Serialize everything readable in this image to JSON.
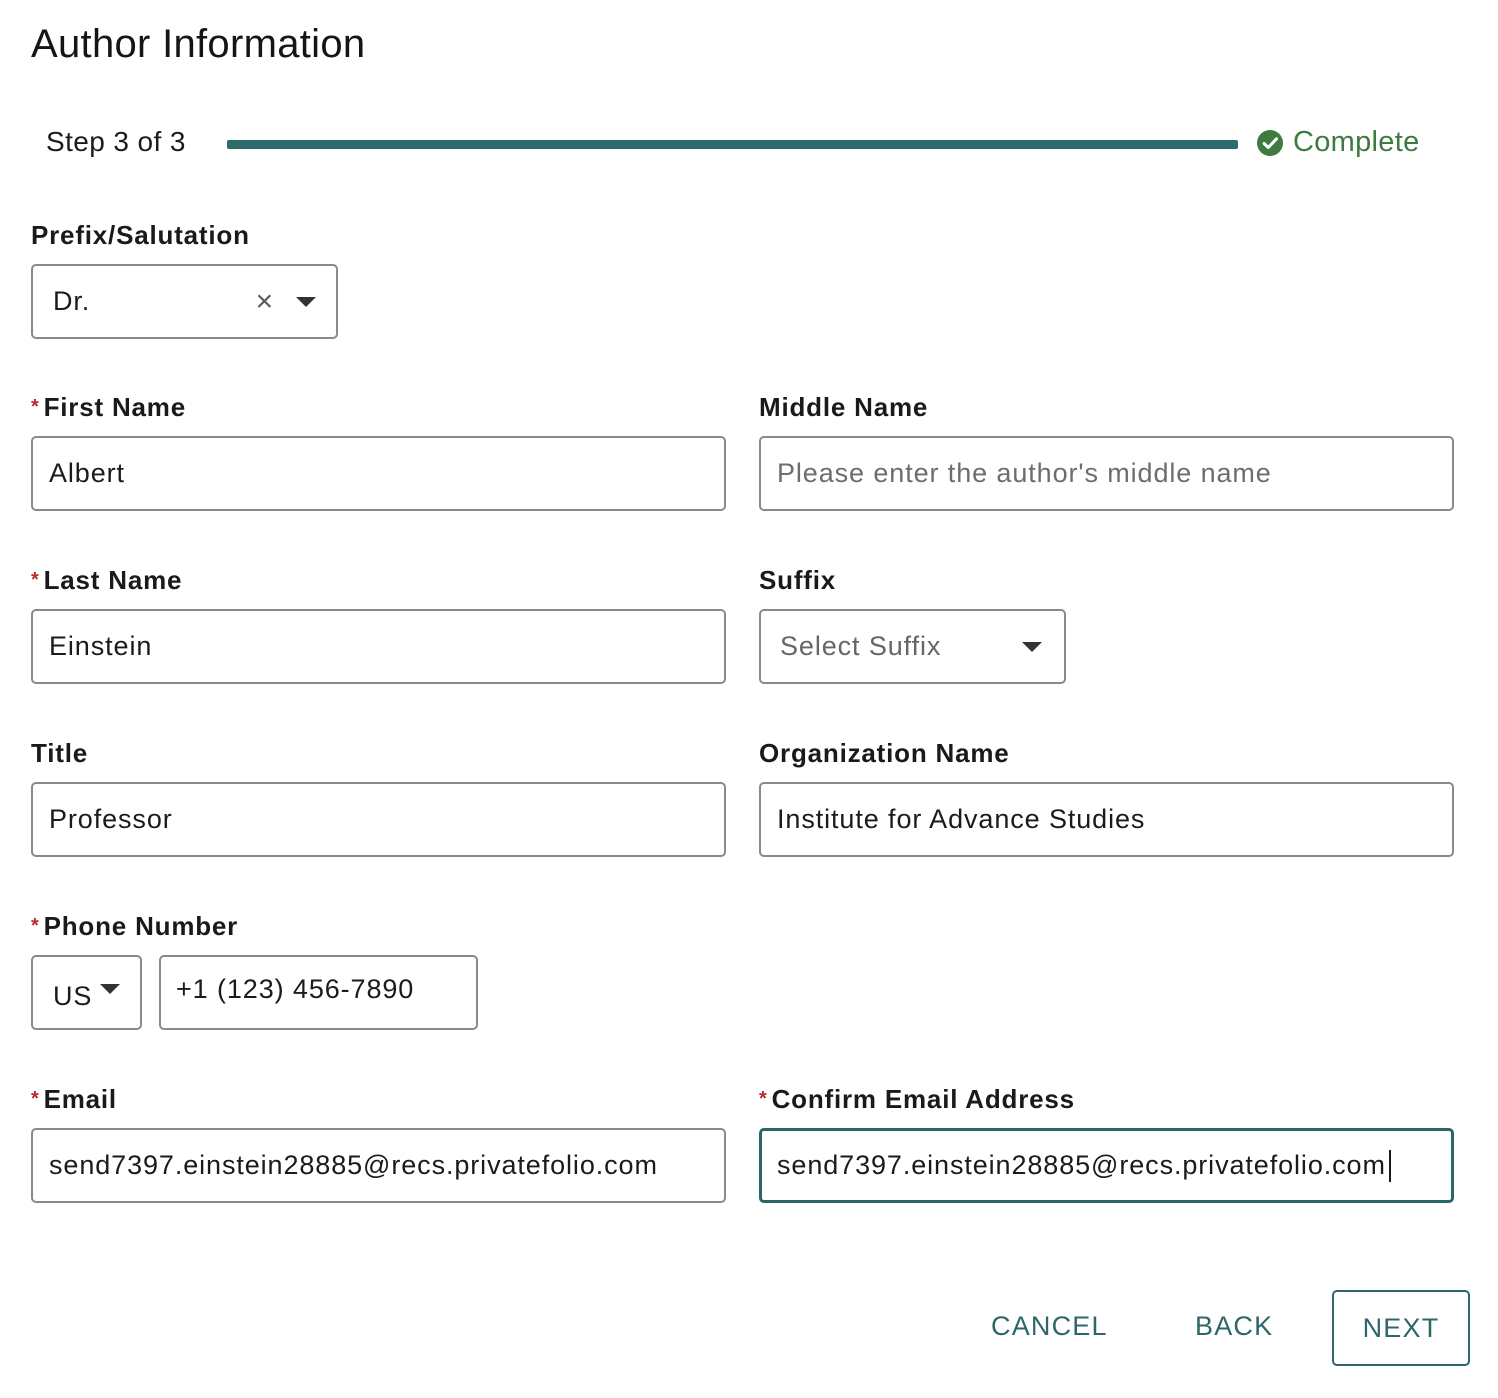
{
  "page": {
    "title": "Author Information"
  },
  "progress": {
    "step_label": "Step 3 of 3",
    "fraction": 1.0,
    "status": "Complete",
    "accent": "#2f6b6b",
    "status_color": "#3f7a40"
  },
  "form": {
    "prefix": {
      "label": "Prefix/Salutation",
      "value": "Dr.",
      "clear_icon": "close-icon",
      "arrow_icon": "chevron-down-icon"
    },
    "first_name": {
      "label": "First Name",
      "required": true,
      "value": "Albert"
    },
    "middle_name": {
      "label": "Middle Name",
      "placeholder": "Please enter the author's middle name",
      "value": ""
    },
    "last_name": {
      "label": "Last Name",
      "required": true,
      "value": "Einstein"
    },
    "suffix": {
      "label": "Suffix",
      "placeholder": "Select Suffix",
      "arrow_icon": "chevron-down-icon"
    },
    "title": {
      "label": "Title",
      "value": "Professor"
    },
    "organization": {
      "label": "Organization Name",
      "value": "Institute for Advance Studies"
    },
    "phone": {
      "label": "Phone Number",
      "required": true,
      "country": "US",
      "value": "+1 (123) 456-7890"
    },
    "email": {
      "label": "Email",
      "required": true,
      "value": "send7397.einstein28885@recs.privatefolio.com"
    },
    "confirm_email": {
      "label": "Confirm Email Address",
      "required": true,
      "value": "send7397.einstein28885@recs.privatefolio.com"
    },
    "required_marker": "*",
    "required_color": "#c0282d"
  },
  "actions": {
    "cancel": "CANCEL",
    "back": "BACK",
    "next": "NEXT"
  }
}
